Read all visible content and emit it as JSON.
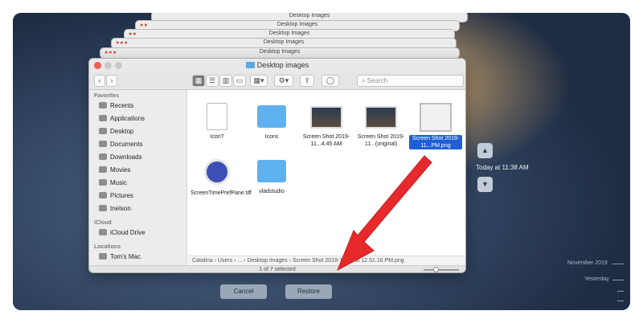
{
  "stack": {
    "titles": [
      "Desktop Images",
      "Desktop Images",
      "Desktop Images",
      "Desktop Images",
      "Desktop Images"
    ]
  },
  "window": {
    "title": "Desktop images",
    "toolbar": {
      "nav_back": "‹",
      "nav_forward": "›",
      "search_placeholder": "Search"
    },
    "sidebar": {
      "favorites_header": "Favorites",
      "favorites": [
        "Recents",
        "Applications",
        "Desktop",
        "Documents",
        "Downloads",
        "Movies",
        "Music",
        "Pictures",
        "tnelson"
      ],
      "icloud_header": "iCloud",
      "icloud": [
        "iCloud Drive"
      ],
      "locations_header": "Locations",
      "locations": [
        "Tom's Mac"
      ]
    },
    "files": [
      {
        "name": "Icon?",
        "kind": "document"
      },
      {
        "name": "Icons",
        "kind": "folder"
      },
      {
        "name": "Screen Shot 2019-11...4.45 AM",
        "kind": "screenshot"
      },
      {
        "name": "Screen Shot 2019-11...(original)",
        "kind": "screenshot"
      },
      {
        "name": "Screen Shot 2019-11...PM.png",
        "kind": "selected"
      },
      {
        "name": "ScreenTimePrefPane.tiff",
        "kind": "app"
      },
      {
        "name": "vladstudio",
        "kind": "folder"
      }
    ],
    "pathbar": "Catalina › Users › ... › Desktop images › Screen Shot 2019-11-30 at 12.51.16 PM.png",
    "status": "1 of 7 selected"
  },
  "timemachine": {
    "current": "Today at 11:38 AM",
    "timeline": [
      "November 2019",
      "Yesterday"
    ]
  },
  "buttons": {
    "cancel": "Cancel",
    "restore": "Restore"
  },
  "colors": {
    "accent": "#1f5fd6",
    "annotation_arrow": "#e8292c",
    "folder": "#5fb0ee"
  }
}
